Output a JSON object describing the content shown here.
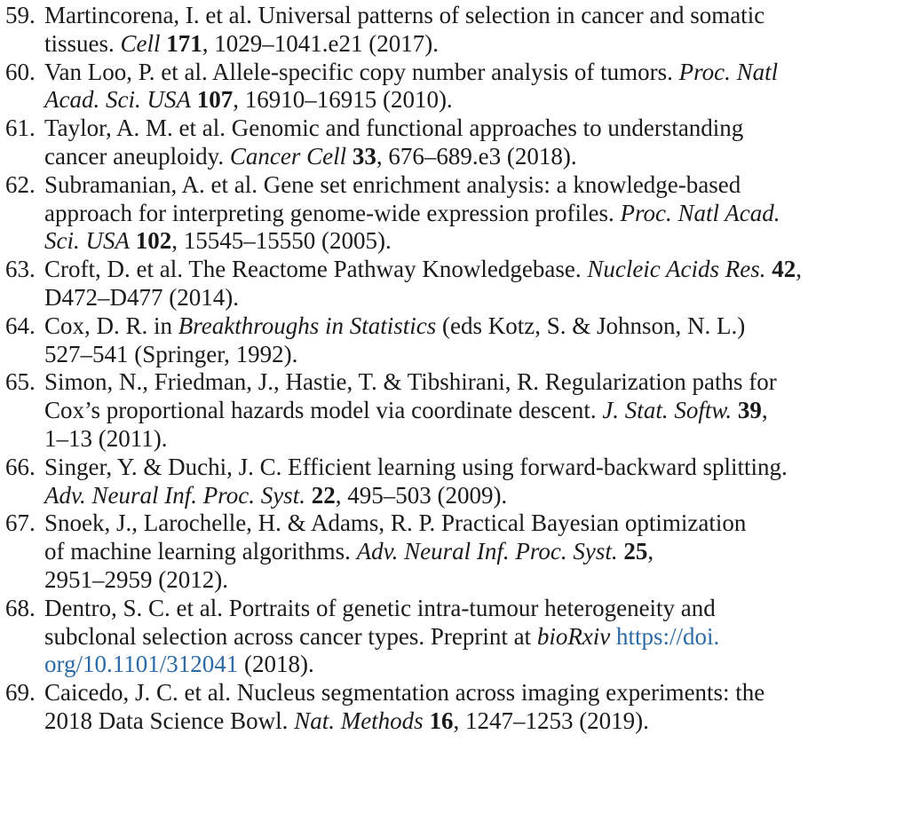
{
  "references": [
    {
      "number": "59.",
      "lines": [
        [
          {
            "t": "Martincorena, I. et al. Universal patterns of selection in cancer and somatic"
          }
        ],
        [
          {
            "t": "tissues. "
          },
          {
            "t": "Cell",
            "s": "i"
          },
          {
            "t": " "
          },
          {
            "t": "171",
            "s": "b"
          },
          {
            "t": ", 1029–1041.e21 (2017)."
          }
        ]
      ]
    },
    {
      "number": "60.",
      "lines": [
        [
          {
            "t": "Van Loo, P. et al. Allele-specific copy number analysis of tumors. "
          },
          {
            "t": "Proc. Natl",
            "s": "i"
          }
        ],
        [
          {
            "t": "Acad. Sci. USA",
            "s": "i"
          },
          {
            "t": " "
          },
          {
            "t": "107",
            "s": "b"
          },
          {
            "t": ", 16910–16915 (2010)."
          }
        ]
      ]
    },
    {
      "number": "61.",
      "lines": [
        [
          {
            "t": "Taylor, A. M. et al. Genomic and functional approaches to understanding"
          }
        ],
        [
          {
            "t": "cancer aneuploidy. "
          },
          {
            "t": "Cancer Cell",
            "s": "i"
          },
          {
            "t": " "
          },
          {
            "t": "33",
            "s": "b"
          },
          {
            "t": ", 676–689.e3 (2018)."
          }
        ]
      ]
    },
    {
      "number": "62.",
      "lines": [
        [
          {
            "t": "Subramanian, A. et al. Gene set enrichment analysis: a knowledge-based"
          }
        ],
        [
          {
            "t": "approach for interpreting genome-wide expression profiles. "
          },
          {
            "t": "Proc. Natl Acad.",
            "s": "i"
          }
        ],
        [
          {
            "t": "Sci. USA",
            "s": "i"
          },
          {
            "t": " "
          },
          {
            "t": "102",
            "s": "b"
          },
          {
            "t": ", 15545–15550 (2005)."
          }
        ]
      ]
    },
    {
      "number": "63.",
      "lines": [
        [
          {
            "t": "Croft, D. et al. The Reactome Pathway Knowledgebase. "
          },
          {
            "t": "Nucleic Acids Res.",
            "s": "i"
          },
          {
            "t": " "
          },
          {
            "t": "42",
            "s": "b"
          },
          {
            "t": ","
          }
        ],
        [
          {
            "t": "D472–D477 (2014)."
          }
        ]
      ]
    },
    {
      "number": "64.",
      "lines": [
        [
          {
            "t": "Cox, D. R. in "
          },
          {
            "t": "Breakthroughs in Statistics",
            "s": "i"
          },
          {
            "t": " (eds Kotz, S. & Johnson, N. L.)"
          }
        ],
        [
          {
            "t": "527–541 (Springer, 1992)."
          }
        ]
      ]
    },
    {
      "number": "65.",
      "lines": [
        [
          {
            "t": "Simon, N., Friedman, J., Hastie, T. & Tibshirani, R. Regularization paths for"
          }
        ],
        [
          {
            "t": "Cox’s proportional hazards model via coordinate descent. "
          },
          {
            "t": "J. Stat. Softw.",
            "s": "i"
          },
          {
            "t": " "
          },
          {
            "t": "39",
            "s": "b"
          },
          {
            "t": ","
          }
        ],
        [
          {
            "t": "1–13 (2011)."
          }
        ]
      ]
    },
    {
      "number": "66.",
      "lines": [
        [
          {
            "t": "Singer, Y. & Duchi, J. C. Efficient learning using forward-backward splitting."
          }
        ],
        [
          {
            "t": "Adv. Neural Inf. Proc. Syst.",
            "s": "i"
          },
          {
            "t": " "
          },
          {
            "t": "22",
            "s": "b"
          },
          {
            "t": ", 495–503 (2009)."
          }
        ]
      ]
    },
    {
      "number": "67.",
      "lines": [
        [
          {
            "t": "Snoek, J., Larochelle, H. & Adams, R. P. Practical Bayesian optimization"
          }
        ],
        [
          {
            "t": "of machine learning algorithms. "
          },
          {
            "t": "Adv. Neural Inf. Proc. Syst.",
            "s": "i"
          },
          {
            "t": " "
          },
          {
            "t": "25",
            "s": "b"
          },
          {
            "t": ","
          }
        ],
        [
          {
            "t": "2951–2959 (2012)."
          }
        ]
      ]
    },
    {
      "number": "68.",
      "lines": [
        [
          {
            "t": "Dentro, S. C. et al. Portraits of genetic intra-tumour heterogeneity and"
          }
        ],
        [
          {
            "t": "subclonal selection across cancer types. Preprint at "
          },
          {
            "t": "bioRxiv",
            "s": "i"
          },
          {
            "t": " "
          },
          {
            "t": "https://doi.",
            "s": "link"
          }
        ],
        [
          {
            "t": "org/10.1101/312041",
            "s": "link"
          },
          {
            "t": " (2018)."
          }
        ]
      ]
    },
    {
      "number": "69.",
      "lines": [
        [
          {
            "t": "Caicedo, J. C. et al. Nucleus segmentation across imaging experiments: the"
          }
        ],
        [
          {
            "t": "2018 Data Science Bowl. "
          },
          {
            "t": "Nat. Methods",
            "s": "i"
          },
          {
            "t": " "
          },
          {
            "t": "16",
            "s": "b"
          },
          {
            "t": ", 1247–1253 (2019)."
          }
        ]
      ]
    }
  ]
}
